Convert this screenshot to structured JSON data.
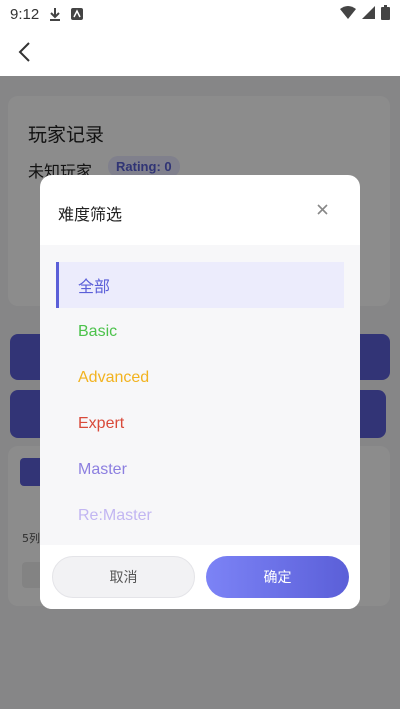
{
  "status_bar": {
    "time": "9:12",
    "icons": [
      "download-icon",
      "app-notification-icon",
      "wifi-icon",
      "signal-icon",
      "battery-icon"
    ]
  },
  "app_bar": {
    "back_icon": "chevron-left-icon"
  },
  "background": {
    "card_title": "玩家记录",
    "player_name": "未知玩家",
    "rating": "Rating: 0",
    "list_text": "5列"
  },
  "dialog": {
    "title": "难度筛选",
    "close_icon": "close-icon",
    "options": [
      {
        "label": "全部",
        "color": "#5b5fd8",
        "selected": true
      },
      {
        "label": "Basic",
        "color": "#4cc24c",
        "selected": false
      },
      {
        "label": "Advanced",
        "color": "#f2b320",
        "selected": false
      },
      {
        "label": "Expert",
        "color": "#d94a3a",
        "selected": false
      },
      {
        "label": "Master",
        "color": "#8c7fe0",
        "selected": false
      },
      {
        "label": "Re:Master",
        "color": "#c2b6f2",
        "selected": false
      }
    ],
    "cancel_label": "取消",
    "confirm_label": "确定"
  },
  "colors": {
    "accent": "#5b5fd8",
    "overlay": "rgba(0,0,0,0.45)"
  }
}
